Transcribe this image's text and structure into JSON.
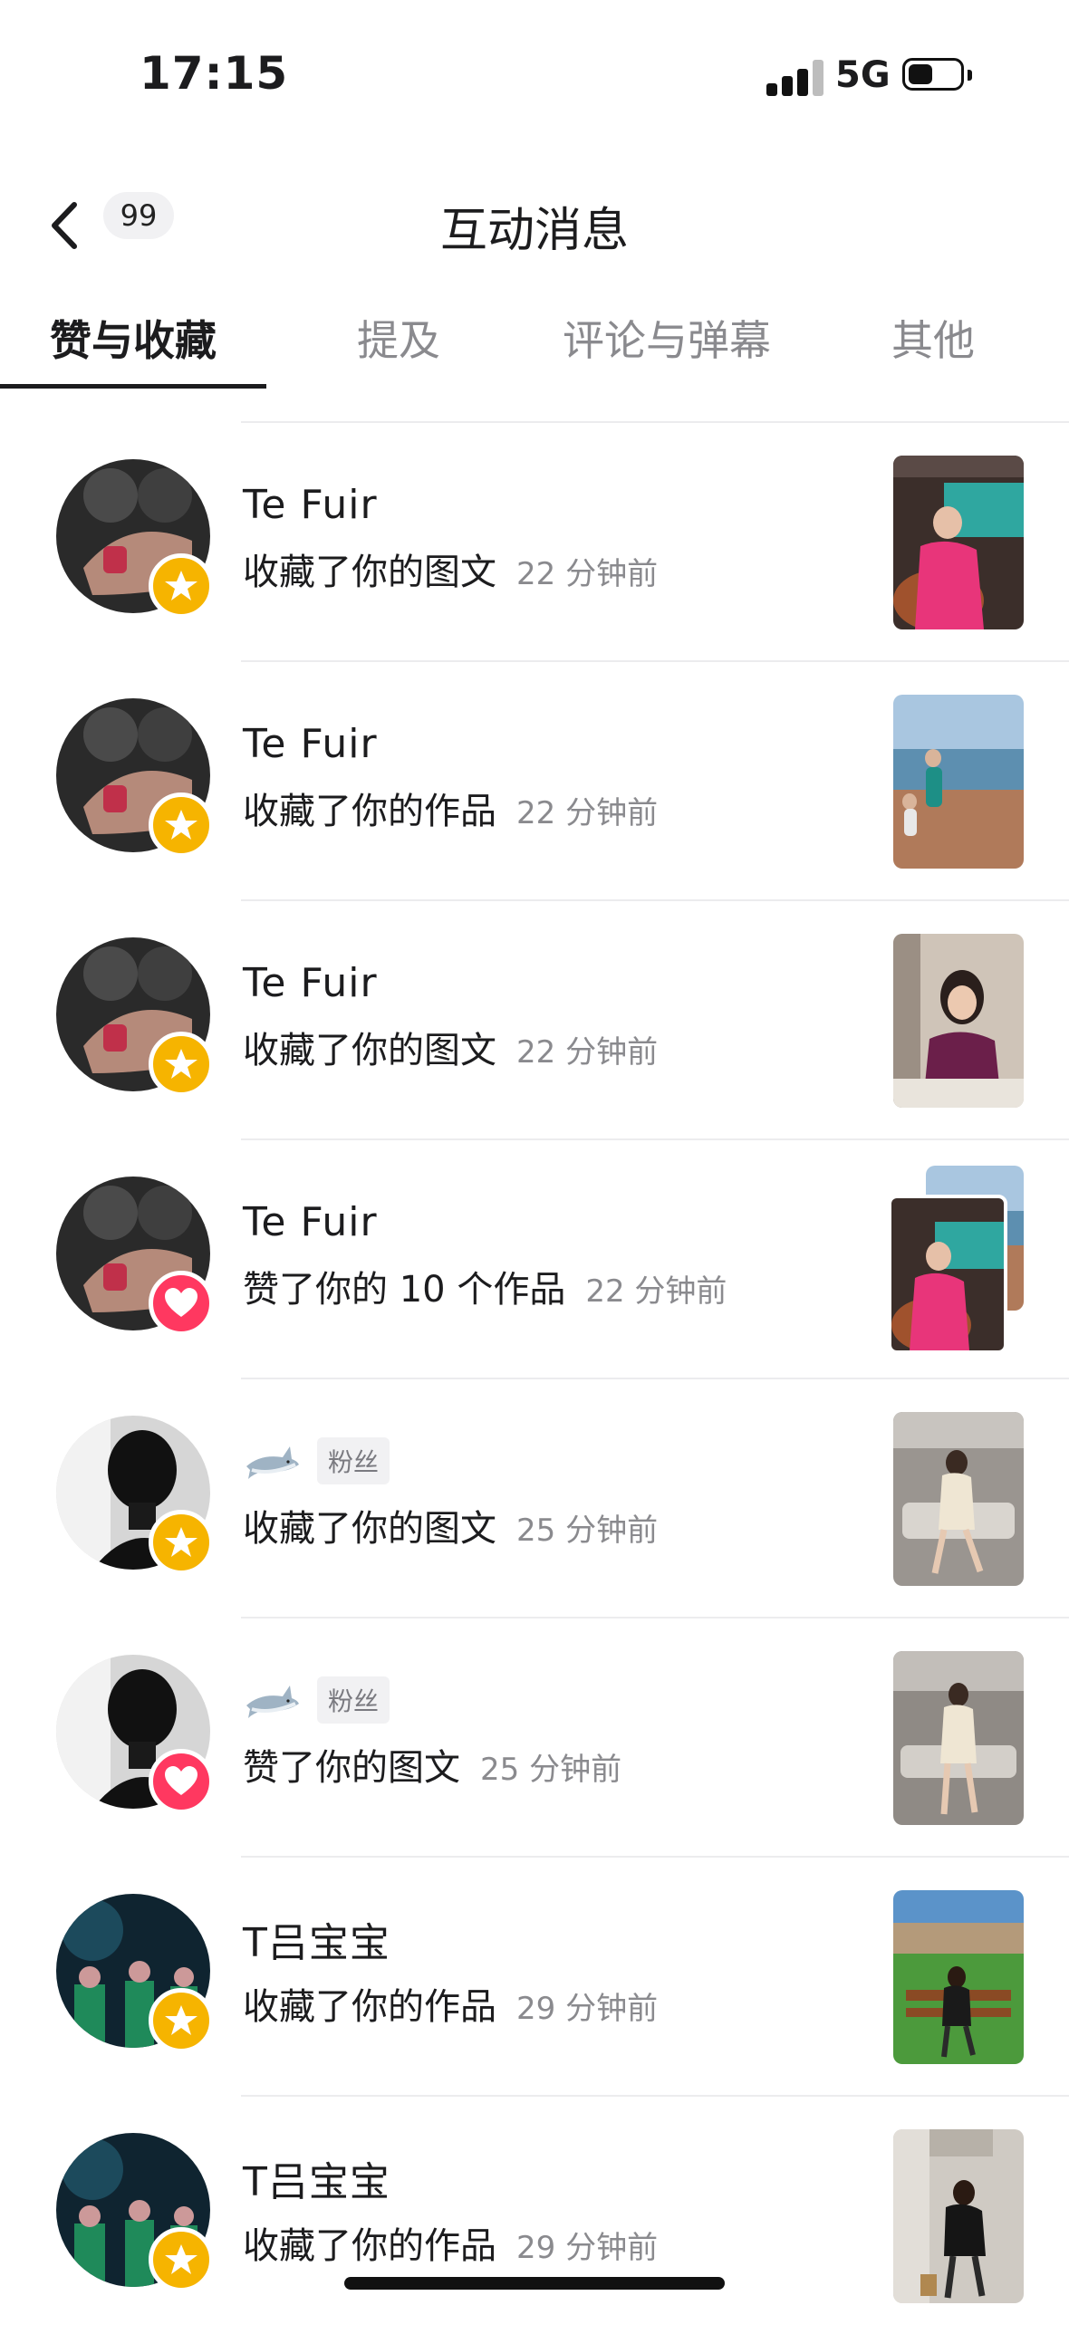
{
  "status_bar": {
    "time": "17:15",
    "network": "5G",
    "battery_icon": "battery-icon",
    "signal_icon": "signal-icon"
  },
  "header": {
    "back_icon": "chevron-left-icon",
    "unread_count": "99",
    "title": "互动消息"
  },
  "tabs": [
    {
      "label": "赞与收藏",
      "active": true
    },
    {
      "label": "提及",
      "active": false
    },
    {
      "label": "评论与弹幕",
      "active": false
    },
    {
      "label": "其他",
      "active": false
    }
  ],
  "colors": {
    "favorite_badge": "#f6b400",
    "like_badge": "#ff3860",
    "text_primary": "#1c1c1e",
    "text_secondary": "#8a8a8e"
  },
  "notifications": [
    {
      "user": "Te  Fuir",
      "action": "收藏了你的图文",
      "time": "22 分钟前",
      "type": "favorite",
      "badge_icon": "star-icon"
    },
    {
      "user": "Te  Fuir",
      "action": "收藏了你的作品",
      "time": "22 分钟前",
      "type": "favorite",
      "badge_icon": "star-icon"
    },
    {
      "user": "Te  Fuir",
      "action": "收藏了你的图文",
      "time": "22 分钟前",
      "type": "favorite",
      "badge_icon": "star-icon"
    },
    {
      "user": "Te  Fuir",
      "action": "赞了你的 10 个作品",
      "time": "22 分钟前",
      "type": "like",
      "badge_icon": "heart-icon"
    },
    {
      "user": "",
      "user_icon": "shark-icon",
      "tag": "粉丝",
      "action": "收藏了你的图文",
      "time": "25 分钟前",
      "type": "favorite",
      "badge_icon": "star-icon"
    },
    {
      "user": "",
      "user_icon": "shark-icon",
      "tag": "粉丝",
      "action": "赞了你的图文",
      "time": "25 分钟前",
      "type": "like",
      "badge_icon": "heart-icon"
    },
    {
      "user": "T吕宝宝",
      "action": "收藏了你的作品",
      "time": "29 分钟前",
      "type": "favorite",
      "badge_icon": "star-icon"
    },
    {
      "user": "T吕宝宝",
      "action": "收藏了你的作品",
      "time": "29 分钟前",
      "type": "favorite",
      "badge_icon": "star-icon"
    }
  ]
}
